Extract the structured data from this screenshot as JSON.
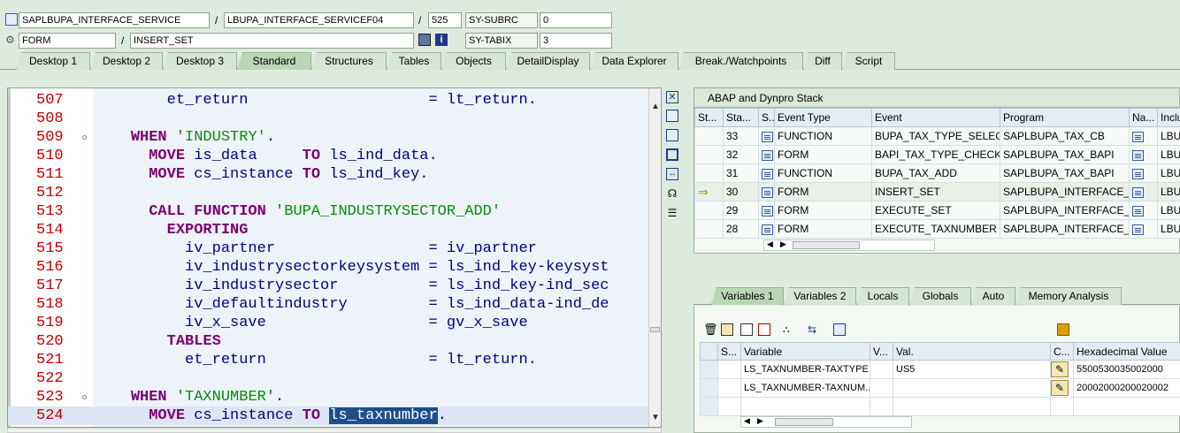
{
  "header": {
    "program": "SAPLBUPA_INTERFACE_SERVICE",
    "include": "LBUPA_INTERFACE_SERVICEF04",
    "line_no": "525",
    "sy_subrc_label": "SY-SUBRC",
    "sy_subrc_value": "0",
    "event_type": "FORM",
    "event_name": "INSERT_SET",
    "sy_tabix_label": "SY-TABIX",
    "sy_tabix_value": "3",
    "slash": "/"
  },
  "tabs": [
    "Desktop 1",
    "Desktop 2",
    "Desktop 3",
    "Standard",
    "Structures",
    "Tables",
    "Objects",
    "DetailDisplay",
    "Data Explorer",
    "Break./Watchpoints",
    "Diff",
    "Script"
  ],
  "active_tab": "Standard",
  "code": [
    {
      "n": "507",
      "parts": [
        [
          "t",
          "        et_return                    = lt_return."
        ]
      ]
    },
    {
      "n": "508",
      "parts": []
    },
    {
      "n": "509",
      "parts": [
        [
          "t",
          "    "
        ],
        [
          "k",
          "WHEN"
        ],
        [
          "t",
          " "
        ],
        [
          "s",
          "'INDUSTRY'"
        ],
        [
          "t",
          "."
        ]
      ]
    },
    {
      "n": "510",
      "parts": [
        [
          "t",
          "      "
        ],
        [
          "k",
          "MOVE"
        ],
        [
          "t",
          " is_data     "
        ],
        [
          "k",
          "TO"
        ],
        [
          "t",
          " ls_ind_data."
        ]
      ]
    },
    {
      "n": "511",
      "parts": [
        [
          "t",
          "      "
        ],
        [
          "k",
          "MOVE"
        ],
        [
          "t",
          " cs_instance "
        ],
        [
          "k",
          "TO"
        ],
        [
          "t",
          " ls_ind_key."
        ]
      ]
    },
    {
      "n": "512",
      "parts": []
    },
    {
      "n": "513",
      "parts": [
        [
          "t",
          "      "
        ],
        [
          "k",
          "CALL FUNCTION"
        ],
        [
          "t",
          " "
        ],
        [
          "s",
          "'BUPA_INDUSTRYSECTOR_ADD'"
        ]
      ]
    },
    {
      "n": "514",
      "parts": [
        [
          "t",
          "        "
        ],
        [
          "k",
          "EXPORTING"
        ]
      ]
    },
    {
      "n": "515",
      "parts": [
        [
          "t",
          "          iv_partner                 = iv_partner"
        ]
      ]
    },
    {
      "n": "516",
      "parts": [
        [
          "t",
          "          iv_industrysectorkeysystem = ls_ind_key-keysyst"
        ]
      ]
    },
    {
      "n": "517",
      "parts": [
        [
          "t",
          "          iv_industrysector          = ls_ind_key-ind_sec"
        ]
      ]
    },
    {
      "n": "518",
      "parts": [
        [
          "t",
          "          iv_defaultindustry         = ls_ind_data-ind_de"
        ]
      ]
    },
    {
      "n": "519",
      "parts": [
        [
          "t",
          "          iv_x_save                  = gv_x_save"
        ]
      ]
    },
    {
      "n": "520",
      "parts": [
        [
          "t",
          "        "
        ],
        [
          "k",
          "TABLES"
        ]
      ]
    },
    {
      "n": "521",
      "parts": [
        [
          "t",
          "          et_return                  = lt_return."
        ]
      ]
    },
    {
      "n": "522",
      "parts": []
    },
    {
      "n": "523",
      "parts": [
        [
          "t",
          "    "
        ],
        [
          "k",
          "WHEN"
        ],
        [
          "t",
          " "
        ],
        [
          "s",
          "'TAXNUMBER'"
        ],
        [
          "t",
          "."
        ]
      ]
    },
    {
      "n": "524",
      "parts": [
        [
          "t",
          "      "
        ],
        [
          "k",
          "MOVE"
        ],
        [
          "t",
          " cs_instance "
        ],
        [
          "k",
          "TO"
        ],
        [
          "t",
          " "
        ],
        [
          "h",
          "ls_taxnumber"
        ],
        [
          "t",
          "."
        ]
      ]
    }
  ],
  "stack_panel": {
    "title": "ABAP and Dynpro Stack",
    "columns": [
      "St...",
      "Sta...",
      "S...",
      "Event Type",
      "Event",
      "Program",
      "Na...",
      "Inclu"
    ],
    "rows": [
      {
        "level": "33",
        "type": "FUNCTION",
        "event": "BUPA_TAX_TYPE_SELEC...",
        "program": "SAPLBUPA_TAX_CB",
        "incl": "LBUP",
        "current": false
      },
      {
        "level": "32",
        "type": "FORM",
        "event": "BAPI_TAX_TYPE_CHECK",
        "program": "SAPLBUPA_TAX_BAPI",
        "incl": "LBUP",
        "current": false
      },
      {
        "level": "31",
        "type": "FUNCTION",
        "event": "BUPA_TAX_ADD",
        "program": "SAPLBUPA_TAX_BAPI",
        "incl": "LBUP",
        "current": false
      },
      {
        "level": "30",
        "type": "FORM",
        "event": "INSERT_SET",
        "program": "SAPLBUPA_INTERFACE_...",
        "incl": "LBUP",
        "current": true
      },
      {
        "level": "29",
        "type": "FORM",
        "event": "EXECUTE_SET",
        "program": "SAPLBUPA_INTERFACE_...",
        "incl": "LBUP",
        "current": false
      },
      {
        "level": "28",
        "type": "FORM",
        "event": "EXECUTE_TAXNUMBER",
        "program": "SAPLBUPA_INTERFACE_...",
        "incl": "LBUP",
        "current": false
      }
    ]
  },
  "var_tabs": [
    "Variables 1",
    "Variables 2",
    "Locals",
    "Globals",
    "Auto",
    "Memory Analysis"
  ],
  "active_var_tab": "Variables 1",
  "variables": {
    "columns": [
      "S...",
      "Variable",
      "V...",
      "Val.",
      "C...",
      "Hexadecimal Value"
    ],
    "rows": [
      {
        "name": "LS_TAXNUMBER-TAXTYPE",
        "value": "US5",
        "hex": "5500530035002000"
      },
      {
        "name": "LS_TAXNUMBER-TAXNUM...",
        "value": "",
        "hex": "20002000200020002"
      }
    ]
  },
  "colors": {
    "bg": "#dfeadf",
    "line_no": "#c00000",
    "keyword": "#7a0070",
    "string": "#0a8a0a",
    "selection": "#1e4e8c"
  }
}
